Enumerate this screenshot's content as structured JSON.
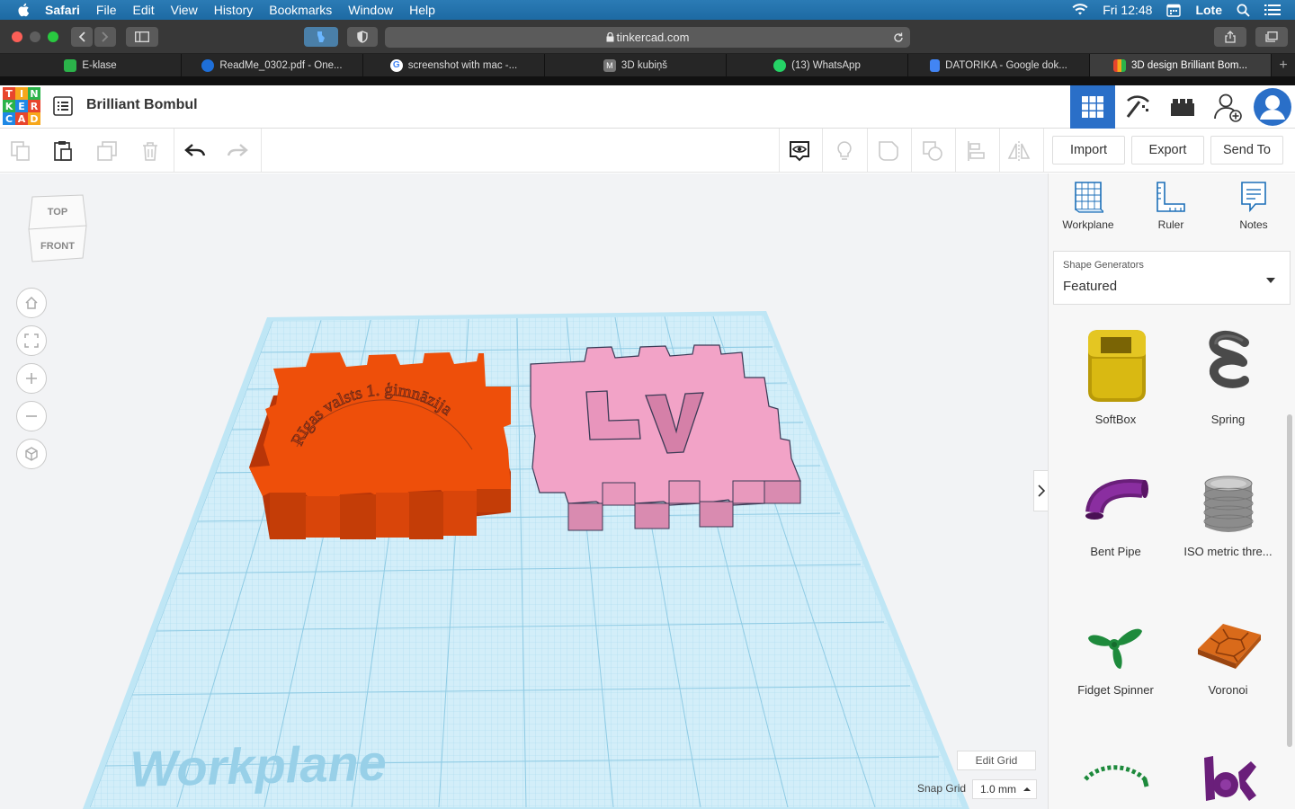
{
  "menubar": {
    "items": [
      "Safari",
      "File",
      "Edit",
      "View",
      "History",
      "Bookmarks",
      "Window",
      "Help"
    ],
    "clock": "Fri 12:48",
    "user": "Lote"
  },
  "safari": {
    "url": "tinkercad.com"
  },
  "tabs": [
    {
      "label": "E-klase",
      "icon_color": "#2bb34a"
    },
    {
      "label": "ReadMe_0302.pdf - One...",
      "icon_color": "#1e6fd9"
    },
    {
      "label": "screenshot with mac -...",
      "icon_color": "#ffffff"
    },
    {
      "label": "3D kubiņš",
      "icon_color": "#777777"
    },
    {
      "label": "(13) WhatsApp",
      "icon_color": "#25d366"
    },
    {
      "label": "DATORIKA - Google dok...",
      "icon_color": "#4285f4"
    },
    {
      "label": "3D design Brilliant Bom...",
      "icon_color": "#e8452c"
    }
  ],
  "tinkercad": {
    "logo_letters": [
      "T",
      "I",
      "N",
      "K",
      "E",
      "R",
      "C",
      "A",
      "D"
    ],
    "design_title": "Brilliant Bombul",
    "accent": "#2a6fc8"
  },
  "toolbar": {
    "import": "Import",
    "export": "Export",
    "send_to": "Send To"
  },
  "viewport": {
    "viewcube_top": "TOP",
    "viewcube_front": "FRONT",
    "workplane_label": "Workplane",
    "edit_grid": "Edit Grid",
    "snap_grid_label": "Snap Grid",
    "snap_grid_value": "1.0 mm",
    "orange_text": "Rīgas valsts 1. ģimnāzija",
    "pink_text": "LV",
    "orange_color": "#e84a0c",
    "pink_color": "#f2a3c7"
  },
  "panel": {
    "tools": [
      "Workplane",
      "Ruler",
      "Notes"
    ],
    "generators_label": "Shape Generators",
    "generators_value": "Featured",
    "shapes": [
      "SoftBox",
      "Spring",
      "Bent Pipe",
      "ISO metric thre...",
      "Fidget Spinner",
      "Voronoi"
    ]
  }
}
